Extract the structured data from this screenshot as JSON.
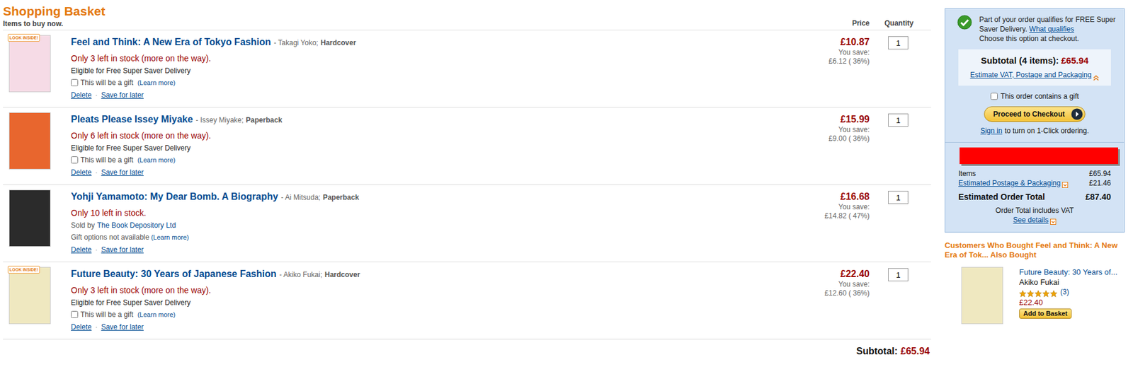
{
  "page": {
    "title": "Shopping Basket",
    "subtitle": "Items to buy now.",
    "price_header": "Price",
    "quantity_header": "Quantity",
    "action_separator": "·"
  },
  "items": [
    {
      "kind": "gift",
      "title": "Feel and Think: A New Era of Tokyo Fashion",
      "byline": "- Takagi Yoko;",
      "format": "Hardcover",
      "badge": "LOOK INSIDE!",
      "cover_color": "#f6dbe6",
      "stock": "Only 3 left in stock (more on the way).",
      "delivery": "Eligible for Free Super Saver Delivery",
      "gift": {
        "label": "This will be a gift",
        "checked": false,
        "learn_more": "(Learn more)"
      },
      "actions": [
        "Delete",
        "Save for later"
      ],
      "price": "£10.87",
      "save_label": "You save:",
      "save": "£6.12 ( 36%)",
      "quantity": "1"
    },
    {
      "kind": "gift",
      "title": "Pleats Please Issey Miyake",
      "byline": "- Issey Miyake;",
      "format": "Paperback",
      "badge": null,
      "cover_color": "#e8662e",
      "stock": "Only 6 left in stock (more on the way).",
      "delivery": "Eligible for Free Super Saver Delivery",
      "gift": {
        "label": "This will be a gift",
        "checked": false,
        "learn_more": "(Learn more)"
      },
      "actions": [
        "Delete",
        "Save for later"
      ],
      "price": "£15.99",
      "save_label": "You save:",
      "save": "£9.00 ( 36%)",
      "quantity": "1"
    },
    {
      "kind": "marketplace",
      "title": "Yohji Yamamoto: My Dear Bomb. A Biography",
      "byline": "- Ai Mitsuda;",
      "format": "Paperback",
      "badge": null,
      "cover_color": "#2b2b2b",
      "stock": "Only 10 left in stock.",
      "seller_label": "Sold by",
      "seller": "The Book Depository Ltd",
      "gift_note": "Gift options not available",
      "learn_more": "(Learn more)",
      "actions": [
        "Delete",
        "Save for later"
      ],
      "price": "£16.68",
      "save_label": "You save:",
      "save": "£14.82 ( 47%)",
      "quantity": "1"
    },
    {
      "kind": "gift",
      "title": "Future Beauty: 30 Years of Japanese Fashion",
      "byline": "- Akiko Fukai;",
      "format": "Hardcover",
      "badge": "LOOK INSIDE!",
      "cover_color": "#efe8c0",
      "stock": "Only 3 left in stock (more on the way).",
      "delivery": "Eligible for Free Super Saver Delivery",
      "gift": {
        "label": "This will be a gift",
        "checked": false,
        "learn_more": "(Learn more)"
      },
      "actions": [
        "Delete",
        "Save for later"
      ],
      "price": "£22.40",
      "save_label": "You save:",
      "save": "£12.60 ( 36%)",
      "quantity": "1"
    }
  ],
  "footer": {
    "label": "Subtotal:",
    "value": "£65.94"
  },
  "sidebar": {
    "notice": {
      "text": "Part of your order qualifies for FREE Super Saver Delivery.",
      "link": "What qualifies",
      "note": "Choose this option at checkout."
    },
    "subtotal": {
      "label": "Subtotal (4 items):",
      "value": "£65.94",
      "estimate_link": "Estimate VAT, Postage and Packaging",
      "expanded": true
    },
    "gift": {
      "label": "This order contains a gift",
      "checked": false
    },
    "checkout_button": "Proceed to Checkout",
    "sign_in": {
      "link": "Sign in",
      "text": "to turn on 1-Click ordering."
    },
    "summary": [
      {
        "kind": "plain",
        "label": "Items",
        "value": "£65.94"
      },
      {
        "kind": "link",
        "label": "Estimated Postage & Packaging",
        "value": "£21.46"
      },
      {
        "kind": "total",
        "label": "Estimated Order Total",
        "value": "£87.40"
      }
    ],
    "vat_note": "Order Total includes VAT",
    "details_link": "See details"
  },
  "recommendations": {
    "title": "Customers Who Bought Feel and Think: A New Era of Tok... Also Bought",
    "items": [
      {
        "title": "Future Beauty: 30 Years of...",
        "author": "Akiko Fukai",
        "stars": 5,
        "reviews": "(3)",
        "price": "£22.40",
        "button": "Add to Basket",
        "cover_color": "#efe8c0"
      }
    ]
  }
}
